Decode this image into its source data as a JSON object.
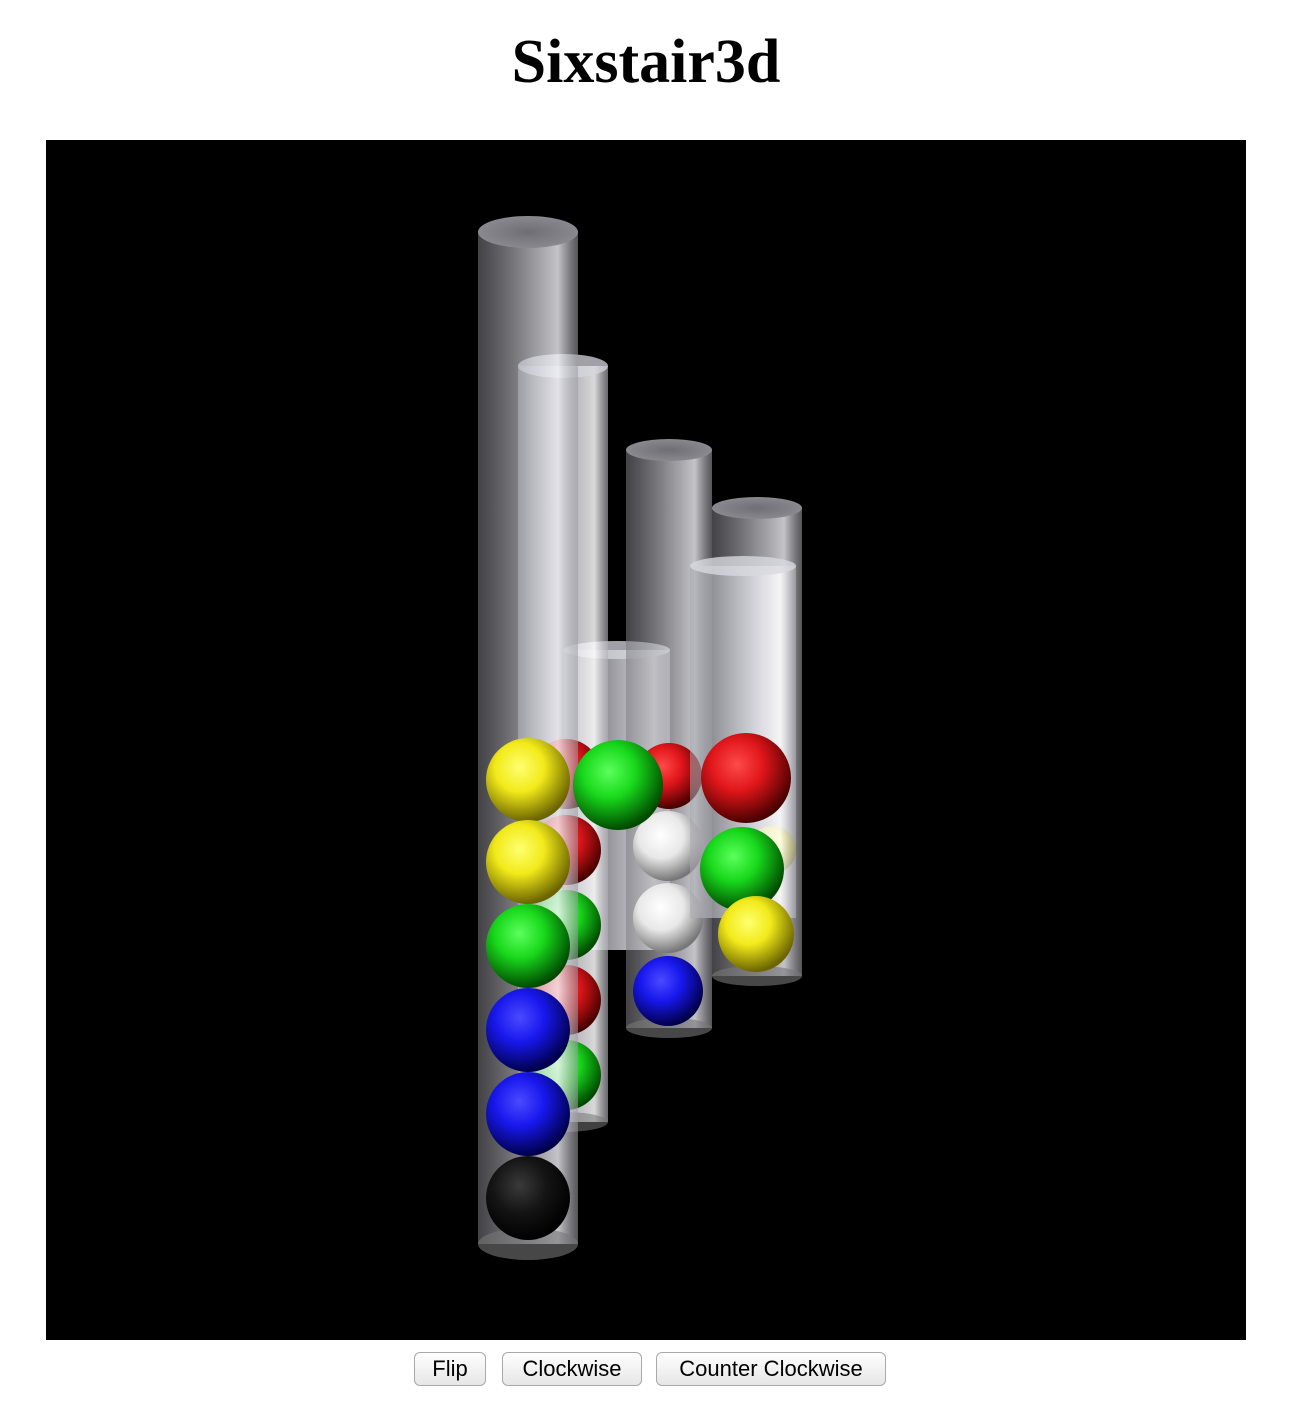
{
  "page": {
    "title": "Sixstair3d"
  },
  "controls": {
    "flip_label": "Flip",
    "clockwise_label": "Clockwise",
    "counter_clockwise_label": "Counter Clockwise"
  },
  "scene": {
    "background": "#000000",
    "ball_colors": {
      "yellow": "#f2ea1a",
      "red": "#e0161a",
      "green": "#19d91c",
      "blue": "#1818ee",
      "white": "#f2f2f2",
      "black": "#111111"
    },
    "tubes": [
      {
        "name": "tube-back-center",
        "height_units": 2,
        "balls": []
      },
      {
        "name": "tube-right-back",
        "height_units": 5,
        "balls": [
          "yellow"
        ]
      },
      {
        "name": "tube-right-front",
        "height_units": 5,
        "balls": [
          "red",
          "green",
          "yellow"
        ]
      },
      {
        "name": "tube-center-front",
        "height_units": 4,
        "balls": [
          "red",
          "white",
          "white",
          "blue"
        ]
      },
      {
        "name": "tube-left-back",
        "height_units": 6,
        "balls": [
          "red",
          "red",
          "green",
          "red",
          "green"
        ]
      },
      {
        "name": "tube-left-front",
        "height_units": 6,
        "balls": [
          "yellow",
          "yellow",
          "green",
          "blue",
          "blue",
          "black"
        ]
      },
      {
        "name": "tube-center-top-ball",
        "height_units": 0,
        "balls": [
          "green"
        ]
      }
    ]
  }
}
